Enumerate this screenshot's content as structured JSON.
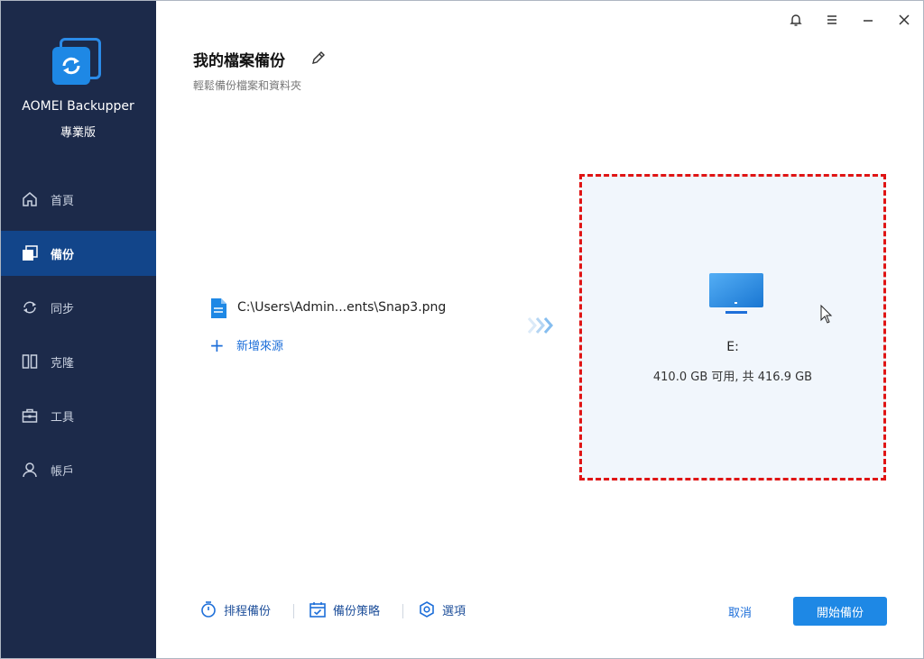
{
  "app": {
    "name": "AOMEI Backupper",
    "edition": "專業版"
  },
  "sidebar": {
    "items": [
      {
        "label": "首頁",
        "icon": "home-icon",
        "active": false
      },
      {
        "label": "備份",
        "icon": "backup-icon",
        "active": true
      },
      {
        "label": "同步",
        "icon": "sync-icon",
        "active": false
      },
      {
        "label": "克隆",
        "icon": "clone-icon",
        "active": false
      },
      {
        "label": "工具",
        "icon": "toolbox-icon",
        "active": false
      },
      {
        "label": "帳戶",
        "icon": "user-icon",
        "active": false
      }
    ]
  },
  "titlebar": {
    "icons": [
      "bell-icon",
      "menu-icon",
      "minimize-icon",
      "close-icon"
    ]
  },
  "header": {
    "title": "我的檔案備份",
    "subtitle": "輕鬆備份檔案和資料夾"
  },
  "source": {
    "path": "C:\\Users\\Admin...ents\\Snap3.png",
    "add_label": "新增來源"
  },
  "destination": {
    "drive": "E:",
    "space": "410.0 GB 可用, 共 416.9 GB"
  },
  "bottom": {
    "schedule_label": "排程備份",
    "scheme_label": "備份策略",
    "options_label": "選項",
    "cancel_label": "取消",
    "start_label": "開始備份"
  },
  "colors": {
    "sidebar_bg": "#1c2a4a",
    "accent": "#1e88e5",
    "highlight_border": "#e01414",
    "dest_bg": "#f1f6fc"
  }
}
